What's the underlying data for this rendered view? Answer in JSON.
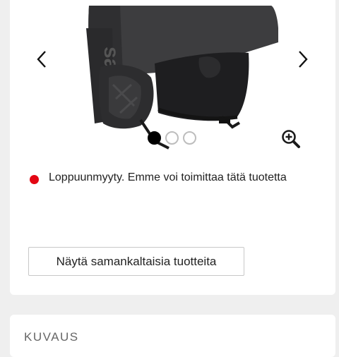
{
  "product": {
    "image": {
      "name": "ski helmet",
      "brand_mark": "sal",
      "slide_count": 3,
      "active_slide": 1
    },
    "nav": {
      "prev_icon": "chevron-left-icon",
      "next_icon": "chevron-right-icon"
    },
    "zoom_icon": "zoom-in-icon",
    "stock": {
      "status_color": "#e30613",
      "text": "Loppuunmyyty. Emme voi toimittaa tätä tuotetta"
    },
    "similar_button_label": "Näytä samankaltaisia tuotteita"
  },
  "description": {
    "title": "KUVAUS"
  }
}
